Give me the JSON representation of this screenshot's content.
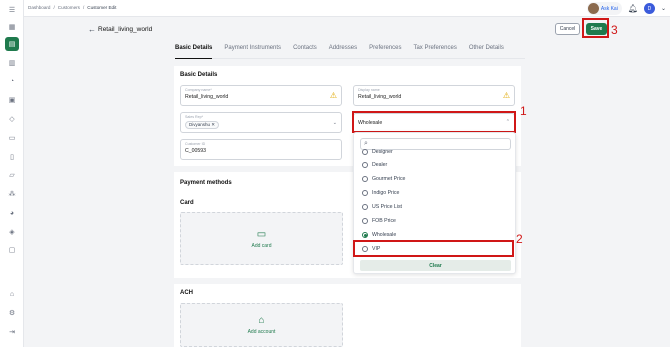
{
  "breadcrumb": [
    "Dashboard",
    "/",
    "Customers",
    "/",
    "Customer Edit"
  ],
  "topbar": {
    "ask_label": "Ask Kai",
    "user_initial": "D"
  },
  "page": {
    "title": "Retail_living_world",
    "cancel_label": "Cancel",
    "save_label": "Save"
  },
  "tabs": [
    "Basic Details",
    "Payment Instruments",
    "Contacts",
    "Addresses",
    "Preferences",
    "Tax Preferences",
    "Other Details"
  ],
  "basic": {
    "section_title": "Basic Details",
    "company_label": "Company name*",
    "company_value": "Retail_living_world",
    "display_label": "Display name",
    "display_value": "Retail_living_world",
    "sales_rep_label": "Sales Rep*",
    "sales_rep_chip": "Divyanshu",
    "price_list_value": "Wholesale",
    "customer_id_label": "Customer ID",
    "customer_id_value": "C_00593"
  },
  "payment": {
    "section_title": "Payment methods",
    "card_title": "Card",
    "add_card": "Add card",
    "ach_title": "ACH",
    "add_account": "Add account"
  },
  "dropdown": {
    "options": [
      "Designer",
      "Dealer",
      "Gourmet Price",
      "Indigo Price",
      "US Price List",
      "FOB Price",
      "Wholesale",
      "VIP"
    ],
    "selected": "Wholesale",
    "clear_label": "Clear"
  },
  "annotations": [
    "1",
    "2",
    "3"
  ]
}
